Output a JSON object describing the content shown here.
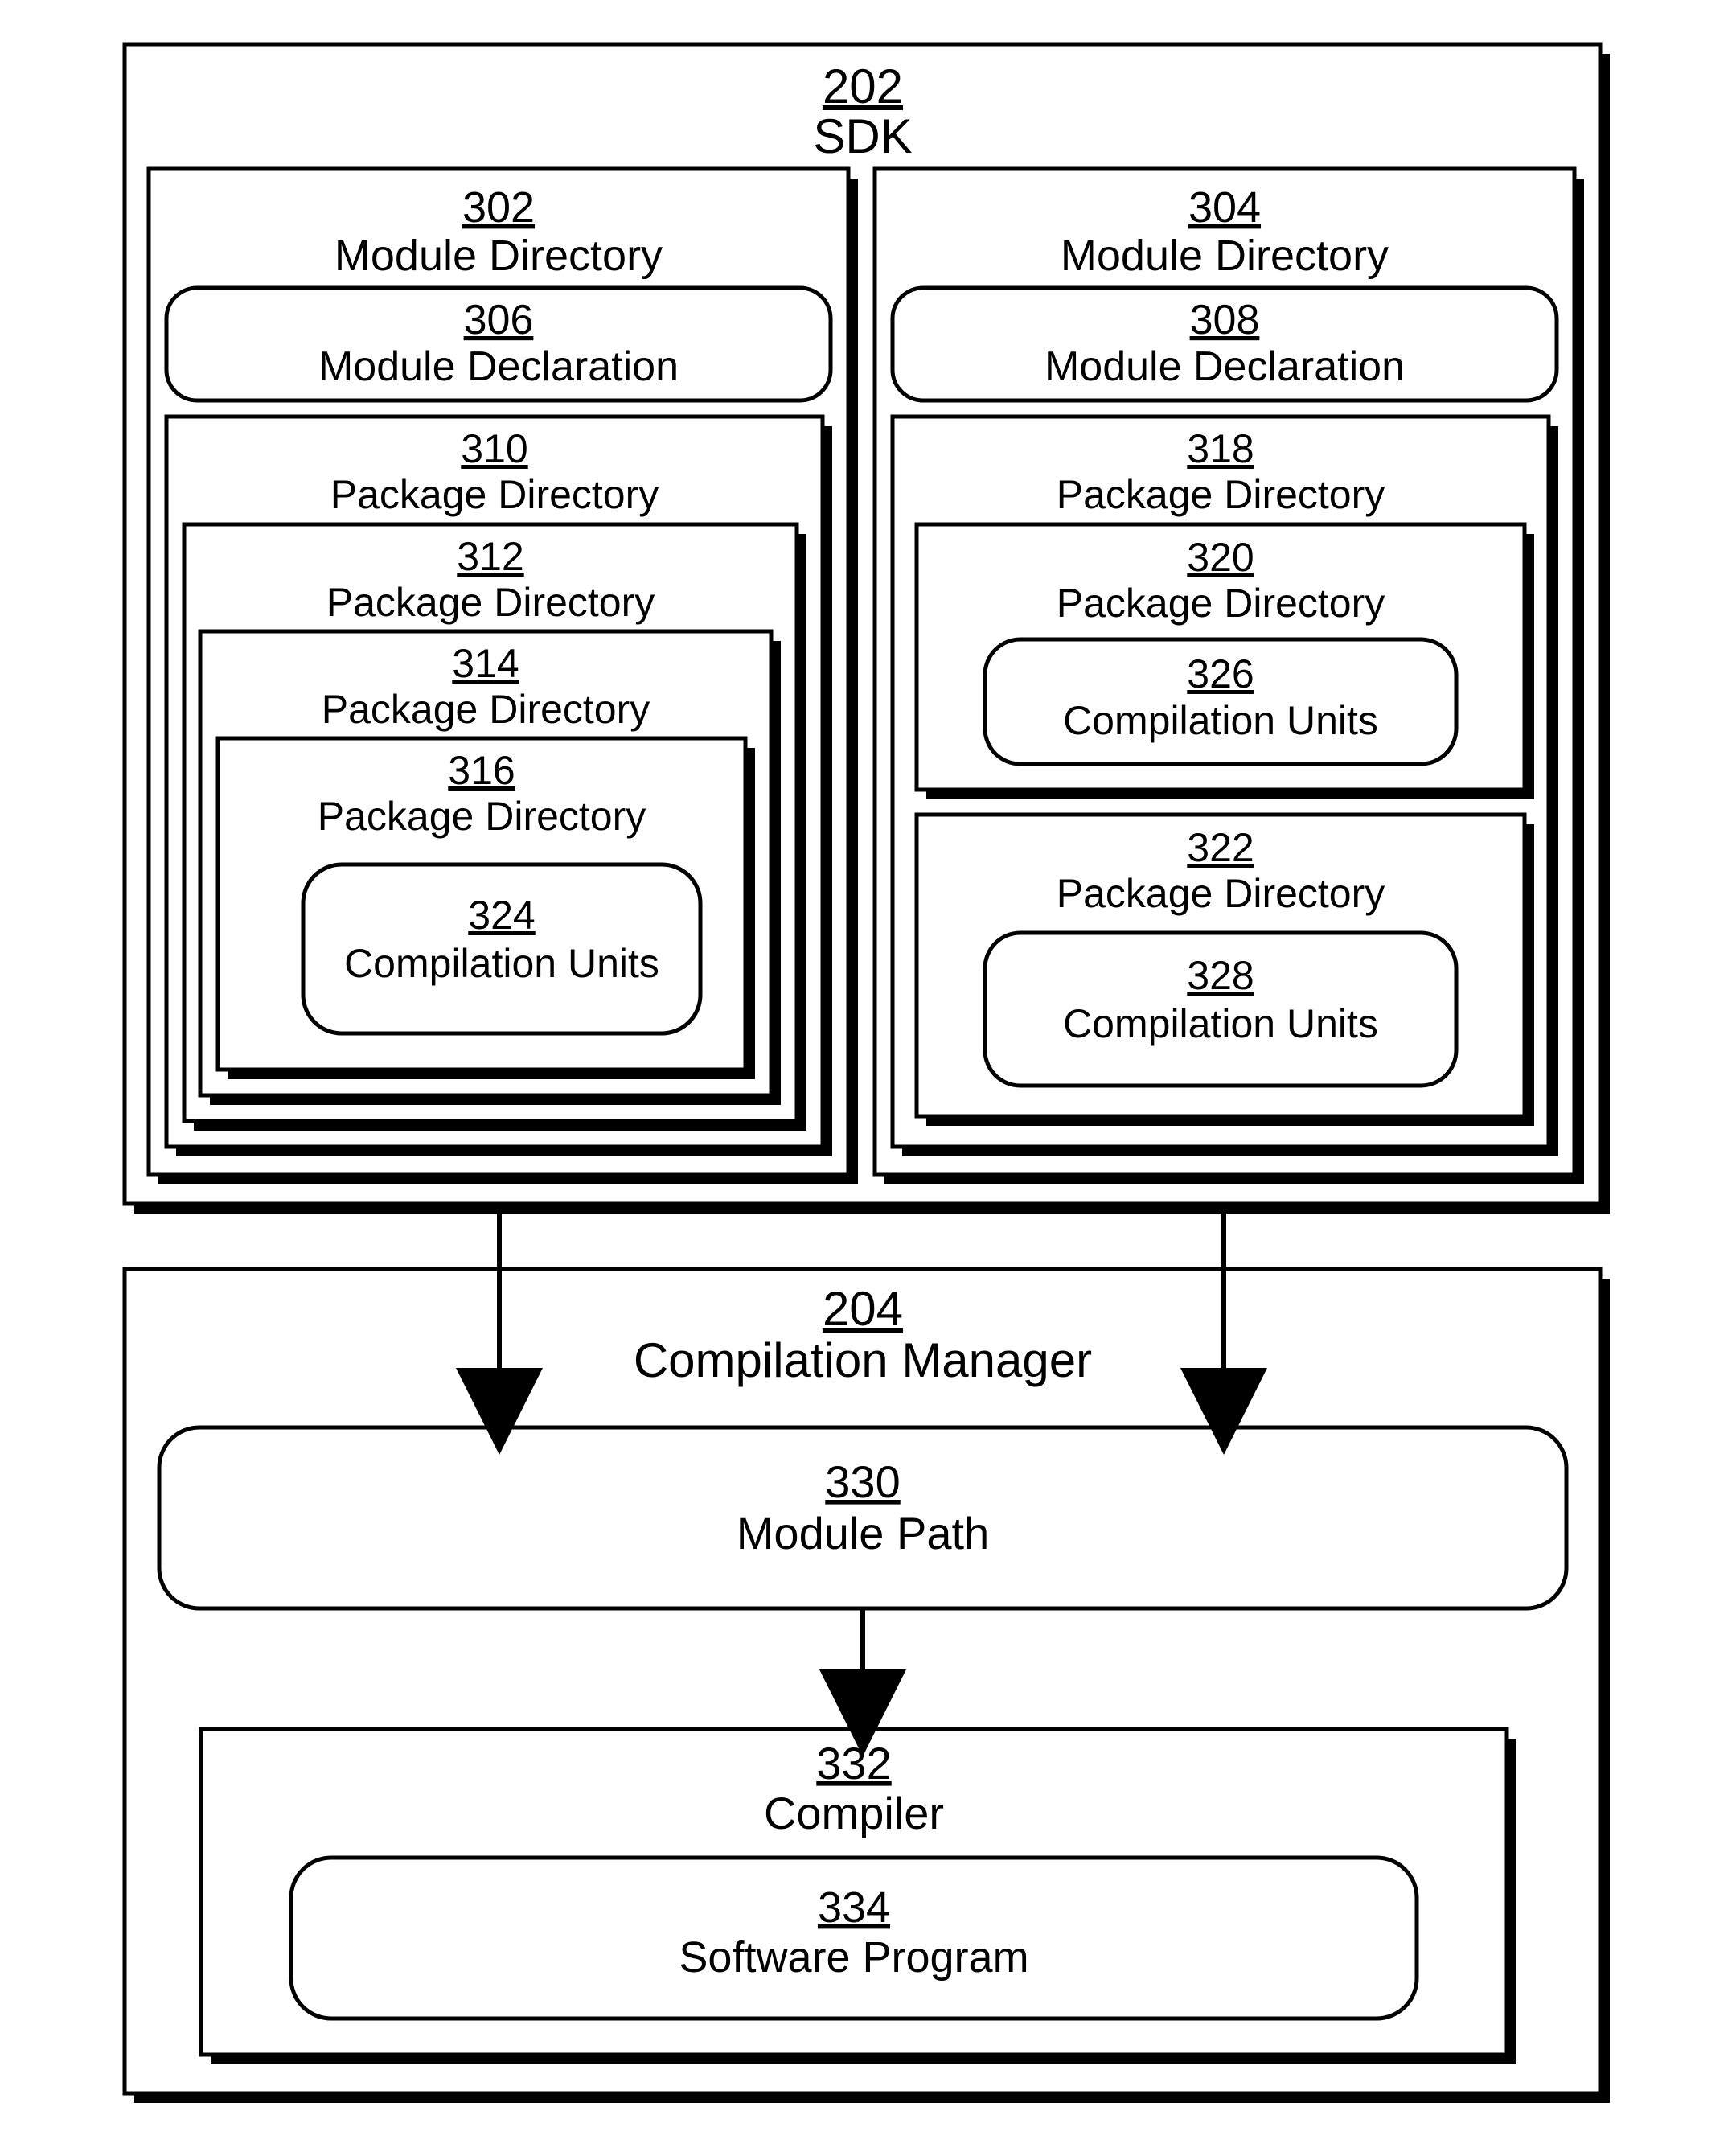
{
  "sdk": {
    "num": "202",
    "label": "SDK"
  },
  "compMgr": {
    "num": "204",
    "label": "Compilation Manager"
  },
  "modDirL": {
    "num": "302",
    "label": "Module Directory"
  },
  "modDirR": {
    "num": "304",
    "label": "Module Directory"
  },
  "modDeclL": {
    "num": "306",
    "label": "Module Declaration"
  },
  "modDeclR": {
    "num": "308",
    "label": "Module Declaration"
  },
  "pkg310": {
    "num": "310",
    "label": "Package Directory"
  },
  "pkg312": {
    "num": "312",
    "label": "Package Directory"
  },
  "pkg314": {
    "num": "314",
    "label": "Package Directory"
  },
  "pkg316": {
    "num": "316",
    "label": "Package Directory"
  },
  "pkg318": {
    "num": "318",
    "label": "Package Directory"
  },
  "pkg320": {
    "num": "320",
    "label": "Package Directory"
  },
  "pkg322": {
    "num": "322",
    "label": "Package Directory"
  },
  "cu324": {
    "num": "324",
    "label": "Compilation Units"
  },
  "cu326": {
    "num": "326",
    "label": "Compilation Units"
  },
  "cu328": {
    "num": "328",
    "label": "Compilation Units"
  },
  "modPath": {
    "num": "330",
    "label": "Module Path"
  },
  "compiler": {
    "num": "332",
    "label": "Compiler"
  },
  "swProg": {
    "num": "334",
    "label": "Software Program"
  }
}
